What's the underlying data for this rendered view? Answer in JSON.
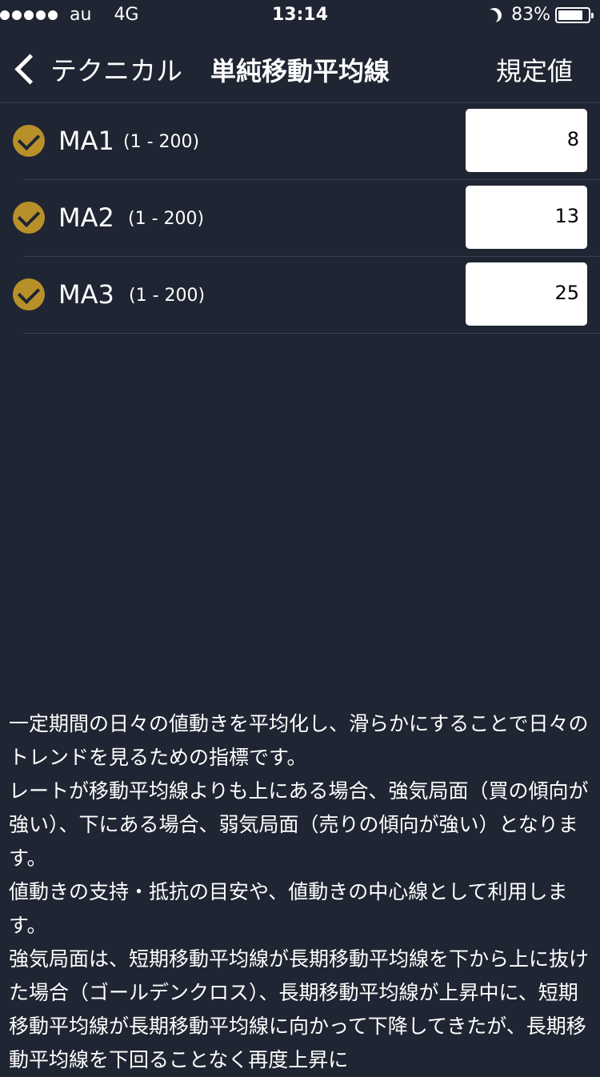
{
  "status_bar": {
    "carrier": "au",
    "network": "4G",
    "time": "13:14",
    "battery_pct": "83%",
    "battery_level": 0.83,
    "icons": [
      "signal-dots",
      "moon-icon",
      "battery-icon"
    ]
  },
  "nav": {
    "back_label": "テクニカル",
    "title": "単純移動平均線",
    "defaults_label": "規定値"
  },
  "settings": [
    {
      "name": "MA1",
      "range": "(1 - 200)",
      "value": "8",
      "checked": true
    },
    {
      "name": "MA2",
      "range": "(1 - 200)",
      "value": "13",
      "checked": true
    },
    {
      "name": "MA3",
      "range": "(1 - 200)",
      "value": "25",
      "checked": true
    }
  ],
  "description": [
    "一定期間の日々の値動きを平均化し、滑らかにすることで日々のトレンドを見るための指標です。",
    "レートが移動平均線よりも上にある場合、強気局面（買の傾向が強い）、下にある場合、弱気局面（売りの傾向が強い）となります。",
    "値動きの支持・抵抗の目安や、値動きの中心線として利用します。",
    "強気局面は、短期移動平均線が長期移動平均線を下から上に抜けた場合（ゴールデンクロス）、長期移動平均線が上昇中に、短期移動平均線が長期移動平均線に向かって下降してきたが、長期移動平均線を下回ることなく再度上昇に"
  ],
  "colors": {
    "background": "#1f2532",
    "accent": "#b8902a",
    "divider": "#3a4150",
    "input_bg": "#ffffff"
  }
}
